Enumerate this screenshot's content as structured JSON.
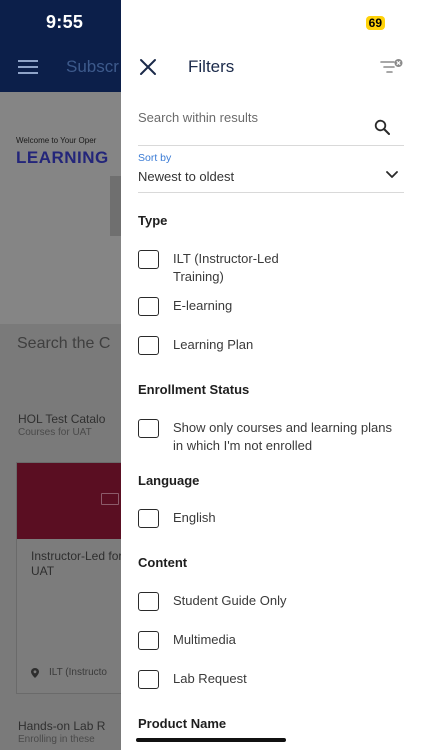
{
  "status_bar": {
    "time": "9:55",
    "battery": "69"
  },
  "background": {
    "header_title": "Subscr",
    "welcome_text": "Welcome to Your Oper",
    "learning_text": "LEARNING",
    "search_title": "Search the C",
    "catalog_title": "HOL Test Catalo",
    "catalog_subtitle": "Courses for UAT",
    "card_title": "Instructor-Led for UAT",
    "card_type": "ILT (Instructo",
    "handson_title": "Hands-on Lab R",
    "handson_subtitle": "Enrolling in these"
  },
  "drawer": {
    "title": "Filters",
    "search_placeholder": "Search within results",
    "sort": {
      "label": "Sort by",
      "value": "Newest to oldest"
    },
    "sections": {
      "type": {
        "title": "Type",
        "options": [
          "ILT (Instructor-Led Training)",
          "E-learning",
          "Learning Plan"
        ]
      },
      "enrollment": {
        "title": "Enrollment Status",
        "options": [
          "Show only courses and learning plans in which I'm not enrolled"
        ]
      },
      "language": {
        "title": "Language",
        "options": [
          "English"
        ]
      },
      "content": {
        "title": "Content",
        "options": [
          "Student Guide Only",
          "Multimedia",
          "Lab Request"
        ]
      },
      "product": {
        "title": "Product Name"
      }
    }
  }
}
